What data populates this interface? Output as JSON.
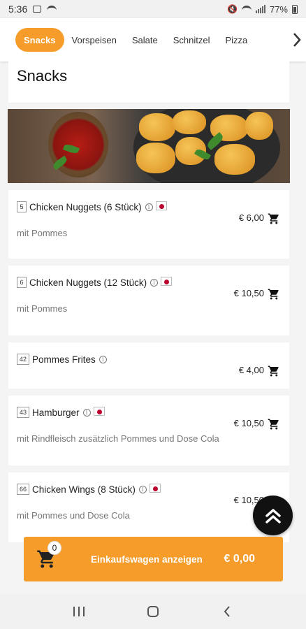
{
  "status": {
    "time": "5:36",
    "battery": "77%"
  },
  "tabs": [
    {
      "label": "Snacks",
      "active": true
    },
    {
      "label": "Vorspeisen",
      "active": false
    },
    {
      "label": "Salate",
      "active": false
    },
    {
      "label": "Schnitzel",
      "active": false
    },
    {
      "label": "Pizza",
      "active": false
    }
  ],
  "section": {
    "title": "Snacks"
  },
  "items": [
    {
      "number": "5",
      "name": "Chicken Nuggets (6 Stück)",
      "price": "€ 6,00",
      "description": "mit Pommes",
      "flag": true
    },
    {
      "number": "6",
      "name": "Chicken Nuggets (12 Stück)",
      "price": "€ 10,50",
      "description": "mit Pommes",
      "flag": true
    },
    {
      "number": "42",
      "name": "Pommes Frites",
      "price": "€ 4,00",
      "description": "",
      "flag": false
    },
    {
      "number": "43",
      "name": "Hamburger",
      "price": "€ 10,50",
      "description": "mit Rindfleisch zusätzlich Pommes und Dose Cola",
      "flag": true
    },
    {
      "number": "66",
      "name": "Chicken Wings (8 Stück)",
      "price": "€ 10,50",
      "description": "mit Pommes und Dose Cola",
      "flag": true
    }
  ],
  "cart": {
    "count": "0",
    "label": "Einkaufswagen anzeigen",
    "total": "€ 0,00"
  },
  "colors": {
    "accent": "#f59c2a",
    "flag_red": "#bc002d"
  }
}
